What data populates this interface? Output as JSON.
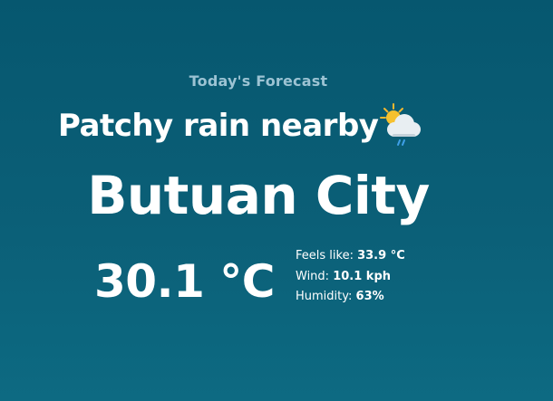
{
  "forecast": {
    "heading": "Today's Forecast",
    "condition": "Patchy rain nearby",
    "condition_icon": "sun-cloud-rain-icon",
    "city": "Butuan City",
    "temperature": "30.1 °C",
    "details": [
      {
        "label": "Feels like:",
        "value": "33.9 °C"
      },
      {
        "label": "Wind:",
        "value": "10.1 kph"
      },
      {
        "label": "Humidity:",
        "value": "63%"
      }
    ]
  },
  "colors": {
    "background_top": "#06576f",
    "background_bottom": "#0d6a82",
    "heading_text": "#9cc3d3",
    "primary_text": "#ffffff"
  }
}
